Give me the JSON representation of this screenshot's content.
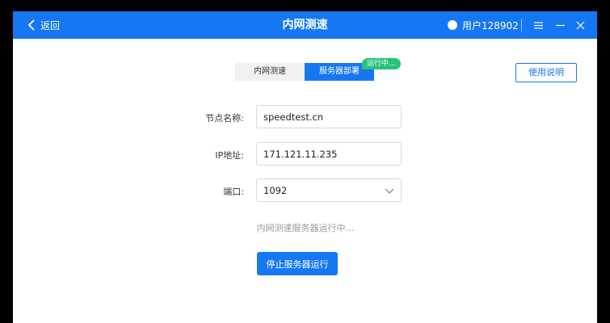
{
  "header": {
    "back_label": "返回",
    "title": "内网测速",
    "user_name": "用户128902",
    "accent_color": "#1677f2"
  },
  "window_controls": {
    "menu_icon": "menu-icon",
    "minimize_icon": "minimize-icon",
    "close_icon": "close-icon"
  },
  "tabs": [
    {
      "label": "内网测速",
      "active": false
    },
    {
      "label": "服务器部署",
      "active": true
    }
  ],
  "running_badge": {
    "label": "运行中…",
    "color": "#27c27a"
  },
  "help_button": {
    "label": "使用说明"
  },
  "form": {
    "node_name": {
      "label": "节点名称:",
      "value": "speedtest.cn"
    },
    "ip_address": {
      "label": "IP地址:",
      "value": "171.121.11.235"
    },
    "port": {
      "label": "端口:",
      "value": "1092"
    }
  },
  "status_text": "内网测速服务器运行中…",
  "stop_button": {
    "label": "停止服务器运行"
  }
}
